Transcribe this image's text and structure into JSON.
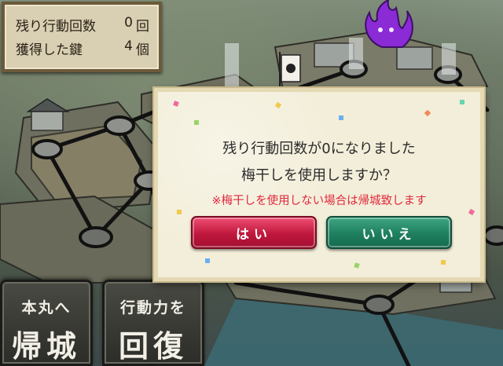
{
  "status": {
    "remaining_actions_label": "残り行動回数",
    "remaining_actions_value": "0",
    "remaining_actions_unit": "回",
    "keys_label": "獲得した鍵",
    "keys_value": "4",
    "keys_unit": "個"
  },
  "dialog": {
    "line1": "残り行動回数が0になりました",
    "line2": "梅干しを使用しますか？",
    "warning": "※梅干しを使用しない場合は帰城致します",
    "yes_label": "はい",
    "no_label": "いいえ"
  },
  "buttons": {
    "return_small": "本丸へ",
    "return_large": "帰城",
    "recover_small": "行動力を",
    "recover_large": "回復"
  },
  "colors": {
    "yes": "#c0173d",
    "no": "#1e7f5f",
    "warning": "#e0273c",
    "enemy_flame": "#8a2bd6"
  },
  "icons": [
    "purple-flame-icon",
    "banner-flag-icon",
    "map-node-icon"
  ]
}
